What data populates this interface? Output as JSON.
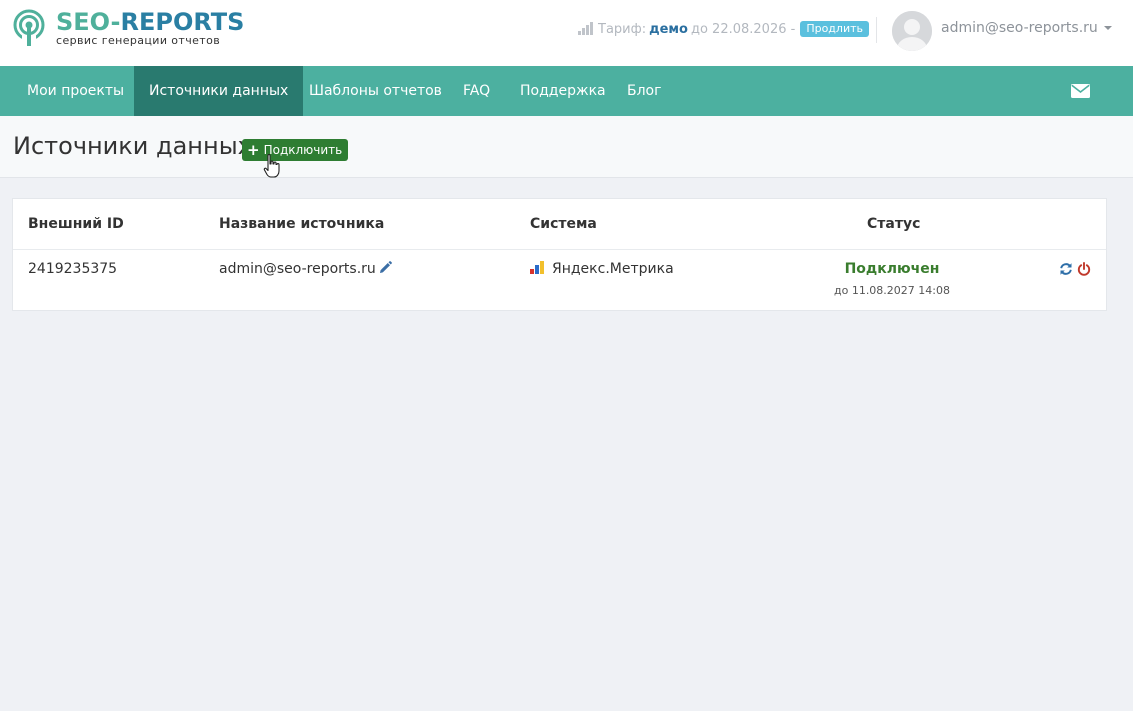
{
  "brand": {
    "title_part1": "SEO-",
    "title_part2": "REPORTS",
    "subtitle": "сервис генерации отчетов",
    "logo_icon": "signal-tower-icon"
  },
  "header": {
    "tariff_label": "Тариф:",
    "plan": "демо",
    "until": "до 22.08.2026 -",
    "extend_label": "Продлить",
    "user_email": "admin@seo-reports.ru"
  },
  "nav": {
    "items": [
      {
        "label": "Мои проекты",
        "active": false
      },
      {
        "label": "Источники данных",
        "active": true
      },
      {
        "label": "Шаблоны отчетов",
        "active": false
      },
      {
        "label": "FAQ",
        "active": false
      },
      {
        "label": "Поддержка",
        "active": false
      },
      {
        "label": "Блог",
        "active": false
      }
    ],
    "mail_icon": "envelope-icon"
  },
  "page": {
    "title": "Источники данных",
    "connect_label": "Подключить"
  },
  "table": {
    "headers": {
      "external_id": "Внешний ID",
      "source_name": "Название источника",
      "system": "Система",
      "status": "Статус"
    },
    "rows": [
      {
        "external_id": "2419235375",
        "source_name": "admin@seo-reports.ru",
        "system": "Яндекс.Метрика",
        "status": "Подключен",
        "status_date": "до 11.08.2027 14:08"
      }
    ]
  },
  "colors": {
    "brand_green": "#4fb09b",
    "brand_blue": "#2a7fa3",
    "nav_bg": "#4cb0a0",
    "nav_active": "#297a6f",
    "connect_button": "#2e7d32",
    "status_ok": "#3a7d2e",
    "extend_badge": "#5bc0de"
  }
}
